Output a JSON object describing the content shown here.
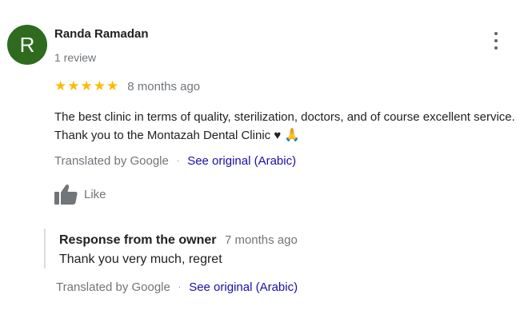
{
  "review": {
    "avatar_letter": "R",
    "author_name": "Randa Ramadan",
    "review_count": "1 review",
    "rating": 5,
    "stars": [
      "★",
      "★",
      "★",
      "★",
      "★"
    ],
    "time_ago": "8 months ago",
    "text": "The best clinic in terms of quality, sterilization, doctors, and of course excellent service. Thank you to the Montazah Dental Clinic ♥",
    "text_emoji": "🙏",
    "translated_by": "Translated by Google",
    "separator": "·",
    "see_original": "See original (Arabic)",
    "like_label": "Like"
  },
  "owner_response": {
    "title": "Response from the owner",
    "time_ago": "7 months ago",
    "text": "Thank you very much, regret",
    "translated_by": "Translated by Google",
    "separator": "·",
    "see_original": "See original (Arabic)"
  },
  "icons": {
    "more": "more-vert-icon",
    "like": "thumbs-up-icon",
    "star": "star-icon"
  },
  "colors": {
    "avatar_bg": "#2e6b1e",
    "star": "#fbbc04",
    "link": "#1a0dab",
    "secondary_text": "#70757a"
  }
}
